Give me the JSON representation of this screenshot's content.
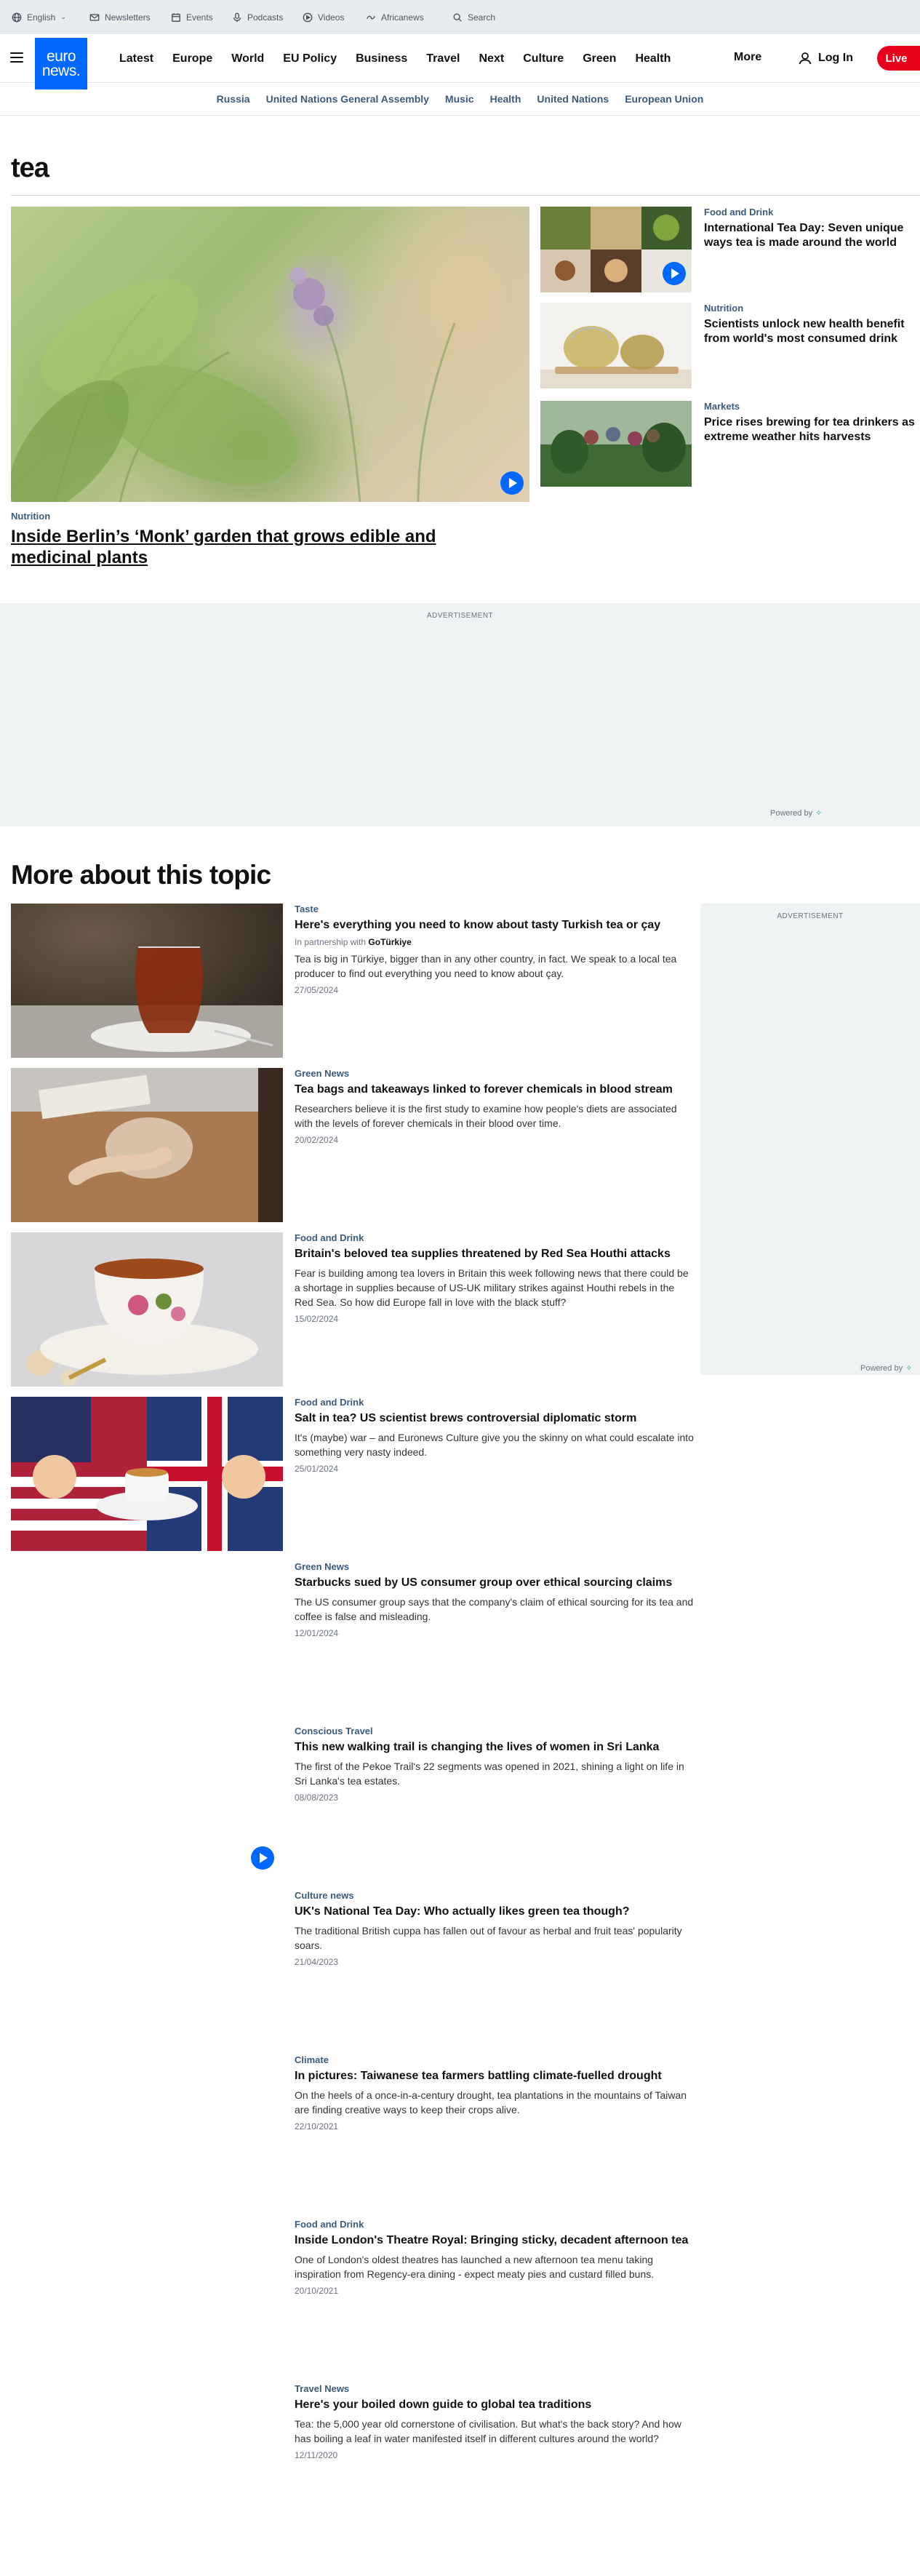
{
  "utility_bar": {
    "language": "English",
    "items": [
      {
        "label": "Newsletters",
        "icon": "mail-icon"
      },
      {
        "label": "Events",
        "icon": "calendar-icon"
      },
      {
        "label": "Podcasts",
        "icon": "microphone-icon"
      },
      {
        "label": "Videos",
        "icon": "play-circle-icon"
      },
      {
        "label": "Africanews",
        "icon": "africanews-icon"
      }
    ],
    "search_label": "Search"
  },
  "header": {
    "logo_line1": "euro",
    "logo_line2": "news.",
    "nav": [
      "Latest",
      "Europe",
      "World",
      "EU Policy",
      "Business",
      "Travel",
      "Next",
      "Culture",
      "Green",
      "Health"
    ],
    "more": "More",
    "login": "Log In",
    "live": "Live",
    "brand_color": "#0067ff",
    "live_color": "#e8001c"
  },
  "trending": [
    "Russia",
    "United Nations General Assembly",
    "Music",
    "Health",
    "United Nations",
    "European Union"
  ],
  "page_title": "tea",
  "hero": {
    "category": "Nutrition",
    "title": "Inside Berlin’s ‘Monk’ garden that grows edible and medicinal plants"
  },
  "side_stories": [
    {
      "category": "Food and Drink",
      "title": "International Tea Day: Seven unique ways tea is made around the world"
    },
    {
      "category": "Nutrition",
      "title": "Scientists unlock new health benefit from world's most consumed drink"
    },
    {
      "category": "Markets",
      "title": "Price rises brewing for tea drinkers as extreme weather hits harvests"
    }
  ],
  "advertisement_label": "ADVERTISEMENT",
  "powered_by": "Powered by",
  "section_title": "More about this topic",
  "articles": [
    {
      "category": "Taste",
      "title": "Here's everything you need to know about tasty Turkish tea or çay",
      "partner_prefix": "In partnership with",
      "partner": "GoTürkiye",
      "description": "Tea is big in Türkiye, bigger than in any other country, in fact. We speak to a local tea producer to find out everything you need to know about çay.",
      "date": "27/05/2024"
    },
    {
      "category": "Green News",
      "title": "Tea bags and takeaways linked to forever chemicals in blood stream",
      "description": "Researchers believe it is the first study to examine how people's diets are associated with the levels of forever chemicals in their blood over time.",
      "date": "20/02/2024"
    },
    {
      "category": "Food and Drink",
      "title": "Britain's beloved tea supplies threatened by Red Sea Houthi attacks",
      "description": "Fear is building among tea lovers in Britain this week following news that there could be a shortage in supplies because of US-UK military strikes against Houthi rebels in the Red Sea. So how did Europe fall in love with the black stuff?",
      "date": "15/02/2024"
    },
    {
      "category": "Food and Drink",
      "title": "Salt in tea? US scientist brews controversial diplomatic storm",
      "description": "It's (maybe) war – and Euronews Culture give you the skinny on what could escalate into something very nasty indeed.",
      "date": "25/01/2024"
    },
    {
      "category": "Green News",
      "title": "Starbucks sued by US consumer group over ethical sourcing claims",
      "description": "The US consumer group says that the company's claim of ethical sourcing for its tea and coffee is false and misleading.",
      "date": "12/01/2024"
    },
    {
      "category": "Conscious Travel",
      "title": "This new walking trail is changing the lives of women in Sri Lanka",
      "description": "The first of the Pekoe Trail's 22 segments was opened in 2021, shining a light on life in Sri Lanka's tea estates.",
      "date": "08/08/2023"
    },
    {
      "category": "Culture news",
      "title": "UK's National Tea Day: Who actually likes green tea though?",
      "description": "The traditional British cuppa has fallen out of favour as herbal and fruit teas' popularity soars.",
      "date": "21/04/2023"
    },
    {
      "category": "Climate",
      "title": "In pictures: Taiwanese tea farmers battling climate-fuelled drought",
      "description": "On the heels of a once-in-a-century drought, tea plantations in the mountains of Taiwan are finding creative ways to keep their crops alive.",
      "date": "22/10/2021"
    },
    {
      "category": "Food and Drink",
      "title": "Inside London's Theatre Royal: Bringing sticky, decadent afternoon tea",
      "description": "One of London's oldest theatres has launched a new afternoon tea menu taking inspiration from Regency-era dining - expect meaty pies and custard filled buns.",
      "date": "20/10/2021"
    },
    {
      "category": "Travel News",
      "title": "Here's your boiled down guide to global tea traditions",
      "description": "Tea: the 5,000 year old cornerstone of civilisation. But what's the back story? And how has boiling a leaf in water manifested itself in different cultures around the world?",
      "date": "12/11/2020"
    }
  ]
}
